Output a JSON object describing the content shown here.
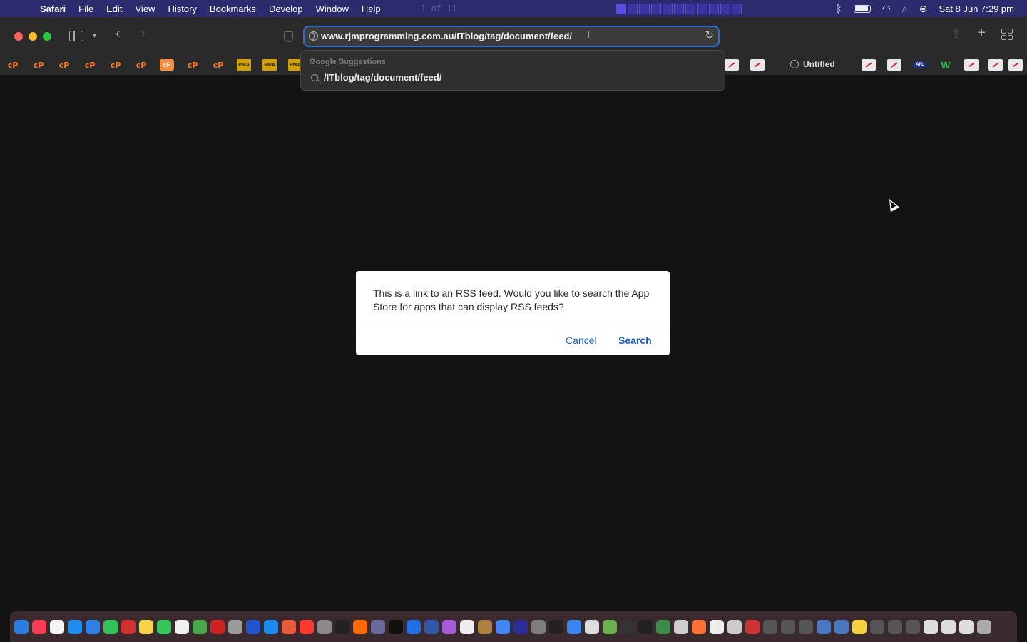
{
  "menubar": {
    "app_name": "Safari",
    "items": [
      "File",
      "Edit",
      "View",
      "History",
      "Bookmarks",
      "Develop",
      "Window",
      "Help"
    ],
    "ghost_text": "1 of 11",
    "status_date_time": "Sat 8 Jun  7:29 pm"
  },
  "toolbar": {
    "url": "www.rjmprogramming.com.au/ITblog/tag/document/feed/"
  },
  "favourites": {
    "untitled_label": "Untitled",
    "cp_label": "cP",
    "pma_label": "PMA",
    "afl_label": "AFL",
    "w_label": "W"
  },
  "suggestions": {
    "header": "Google Suggestions",
    "item": "/ITblog/tag/document/feed/"
  },
  "dialog": {
    "message": "This is a link to an RSS feed. Would you like to search the App Store for apps that can display RSS feeds?",
    "cancel_label": "Cancel",
    "search_label": "Search"
  },
  "dock": {
    "app_colors": [
      "#2a7de1",
      "#fb3c54",
      "#f5f5f5",
      "#1e8cf0",
      "#2f7fe6",
      "#32c25a",
      "#d32f2f",
      "#f7d34a",
      "#34c759",
      "#f0f0f0",
      "#4aa84a",
      "#cc2222",
      "#9b9b9b",
      "#2255cc",
      "#1c8bf0",
      "#e85b3a",
      "#ff3b30",
      "#8a8a8a",
      "#222222",
      "#ff6a00",
      "#6b6b9b",
      "#111111",
      "#1f6fe8",
      "#3355aa",
      "#a65bd8",
      "#eeeeee",
      "#b08040",
      "#4285f4",
      "#2d2d9a",
      "#7d7d7d",
      "#222222",
      "#3a86f0",
      "#dddddd",
      "#6ab04c",
      "#333333",
      "#222222",
      "#3d8b4a",
      "#cfcfcf",
      "#ff7139",
      "#eeeeee",
      "#cccccc",
      "#cc3333",
      "#555555",
      "#555555",
      "#555555",
      "#4a78c0",
      "#4a78c0",
      "#f4d03f",
      "#555555",
      "#555555",
      "#555555",
      "#dddddd",
      "#dddddd",
      "#dddddd",
      "#aaaaaa"
    ]
  }
}
